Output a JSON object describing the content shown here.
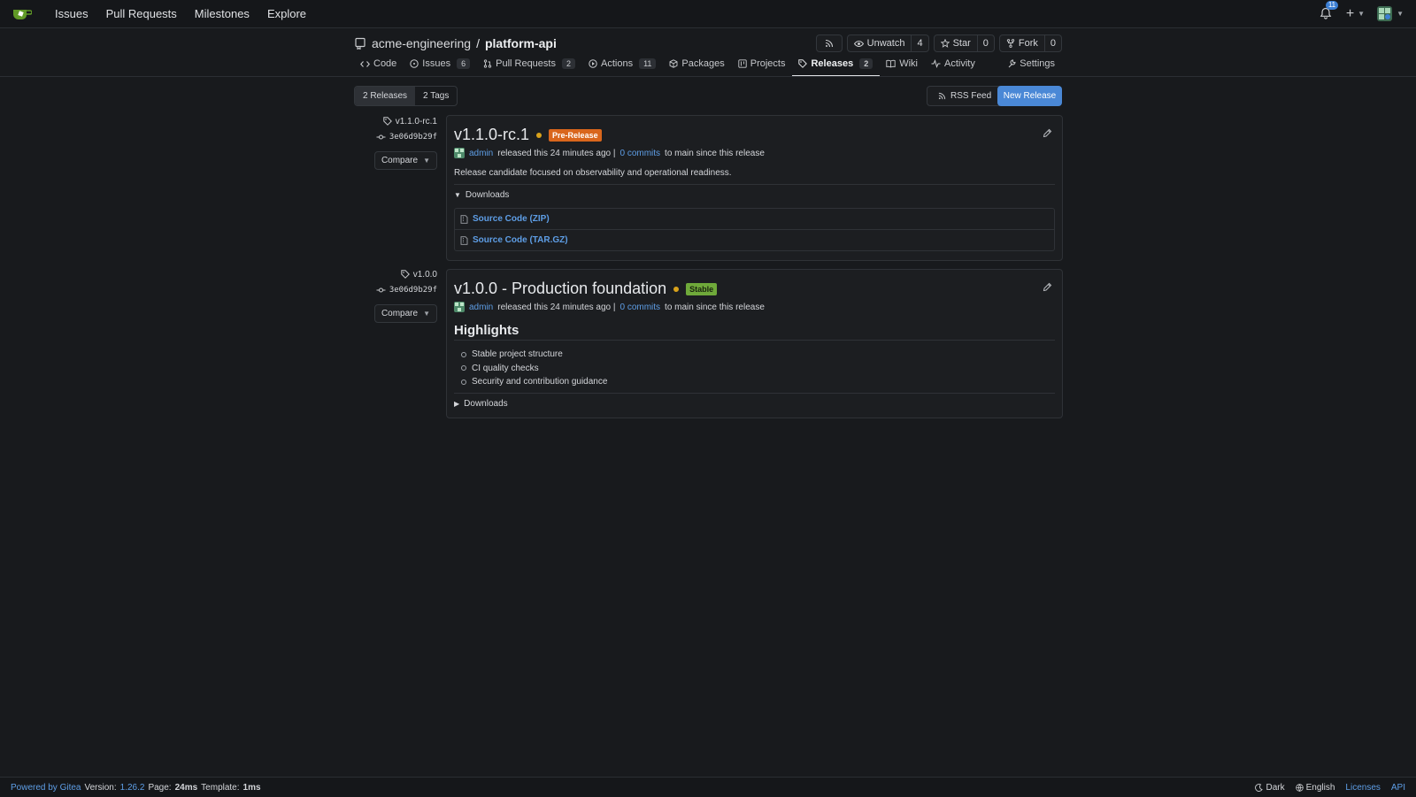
{
  "topnav": {
    "items": [
      "Issues",
      "Pull Requests",
      "Milestones",
      "Explore"
    ],
    "notification_count": "11"
  },
  "repo": {
    "owner": "acme-engineering",
    "separator": "/",
    "name": "platform-api",
    "unwatch_label": "Unwatch",
    "unwatch_count": "4",
    "star_label": "Star",
    "star_count": "0",
    "fork_label": "Fork",
    "fork_count": "0"
  },
  "tabs": {
    "code": "Code",
    "issues": "Issues",
    "issues_count": "6",
    "pulls": "Pull Requests",
    "pulls_count": "2",
    "actions": "Actions",
    "actions_count": "11",
    "packages": "Packages",
    "projects": "Projects",
    "releases": "Releases",
    "releases_count": "2",
    "wiki": "Wiki",
    "activity": "Activity",
    "settings": "Settings"
  },
  "toolbar": {
    "releases_tab": "2 Releases",
    "tags_tab": "2 Tags",
    "rss_feed": "RSS Feed",
    "new_release": "New Release"
  },
  "releases": [
    {
      "tag": "v1.1.0-rc.1",
      "sha": "3e06d9b29f",
      "compare": "Compare",
      "title": "v1.1.0-rc.1",
      "label": "Pre-Release",
      "author": "admin",
      "released_text": "released this 24 minutes ago |",
      "commits_link": "0 commits",
      "since_text": "to main since this release",
      "description": "Release candidate focused on observability and operational readiness.",
      "downloads_label": "Downloads",
      "downloads": [
        "Source Code (ZIP)",
        "Source Code (TAR.GZ)"
      ]
    },
    {
      "tag": "v1.0.0",
      "sha": "3e06d9b29f",
      "compare": "Compare",
      "title": "v1.0.0 - Production foundation",
      "label": "Stable",
      "author": "admin",
      "released_text": "released this 24 minutes ago |",
      "commits_link": "0 commits",
      "since_text": "to main since this release",
      "heading": "Highlights",
      "bullets": [
        "Stable project structure",
        "CI quality checks",
        "Security and contribution guidance"
      ],
      "downloads_label": "Downloads"
    }
  ],
  "footer": {
    "powered_by": "Powered by Gitea",
    "version_label": "Version:",
    "version": "1.26.2",
    "page_label": "Page:",
    "page_time": "24ms",
    "template_label": "Template:",
    "template_time": "1ms",
    "theme": "Dark",
    "language": "English",
    "licenses": "Licenses",
    "api": "API"
  }
}
